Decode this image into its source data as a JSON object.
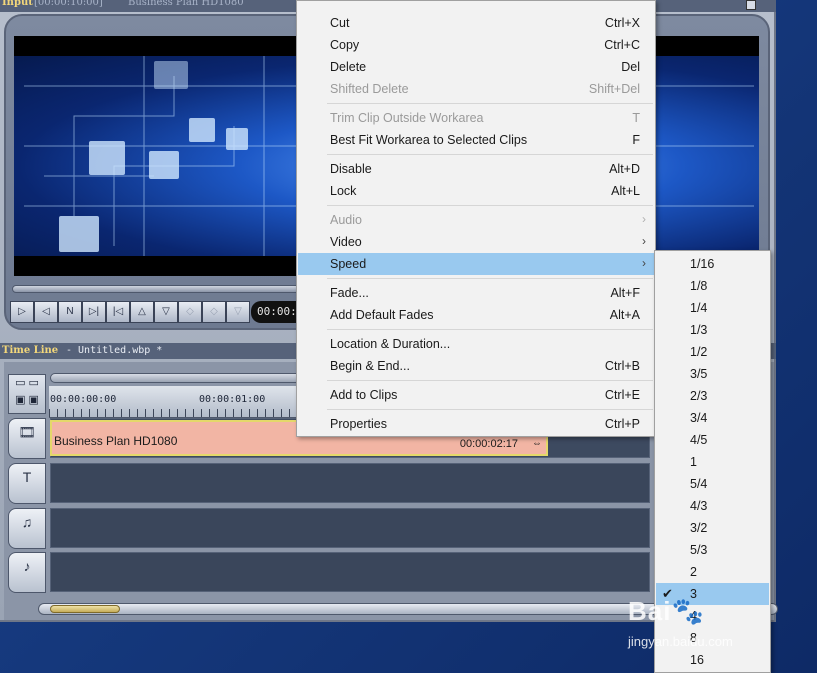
{
  "input_window": {
    "title": "Input",
    "timecode": "[00:00:10:00]",
    "clip_name": "Business Plan HD1080",
    "transport_timecode": "00:00:"
  },
  "timeline": {
    "title": "Time Line",
    "file": "- Untitled.wbp *",
    "ruler": {
      "start": "00:00:00:00",
      "mark": "00:00:01:00"
    },
    "clip": {
      "name": "Business Plan HD1080",
      "duration": "00:00:02:17"
    }
  },
  "context_menu": {
    "items": [
      {
        "label": "Cut",
        "shortcut": "Ctrl+X",
        "enabled": true
      },
      {
        "label": "Copy",
        "shortcut": "Ctrl+C",
        "enabled": true
      },
      {
        "label": "Delete",
        "shortcut": "Del",
        "enabled": true
      },
      {
        "label": "Shifted Delete",
        "shortcut": "Shift+Del",
        "enabled": false
      },
      {
        "label": "Trim Clip Outside Workarea",
        "shortcut": "T",
        "enabled": false
      },
      {
        "label": "Best Fit Workarea to Selected Clips",
        "shortcut": "F",
        "enabled": true
      },
      {
        "label": "Disable",
        "shortcut": "Alt+D",
        "enabled": true
      },
      {
        "label": "Lock",
        "shortcut": "Alt+L",
        "enabled": true
      },
      {
        "label": "Audio",
        "shortcut": "",
        "enabled": false,
        "submenu": true
      },
      {
        "label": "Video",
        "shortcut": "",
        "enabled": true,
        "submenu": true
      },
      {
        "label": "Speed",
        "shortcut": "",
        "enabled": true,
        "submenu": true,
        "highlighted": true
      },
      {
        "label": "Fade...",
        "shortcut": "Alt+F",
        "enabled": true
      },
      {
        "label": "Add Default Fades",
        "shortcut": "Alt+A",
        "enabled": true
      },
      {
        "label": "Location & Duration...",
        "shortcut": "",
        "enabled": true
      },
      {
        "label": "Begin & End...",
        "shortcut": "Ctrl+B",
        "enabled": true
      },
      {
        "label": "Add to Clips",
        "shortcut": "Ctrl+E",
        "enabled": true
      },
      {
        "label": "Properties",
        "shortcut": "Ctrl+P",
        "enabled": true
      }
    ]
  },
  "speed_submenu": {
    "options": [
      "1/16",
      "1/8",
      "1/4",
      "1/3",
      "1/2",
      "3/5",
      "2/3",
      "3/4",
      "4/5",
      "1",
      "5/4",
      "4/3",
      "3/2",
      "5/3",
      "2",
      "3",
      "4",
      "8",
      "16"
    ],
    "selected": "3"
  },
  "watermark": {
    "brand": "Bai",
    "url": "jingyan.baidu.com"
  },
  "colors": {
    "menu_highlight": "#99c9ef",
    "clip": "#f2b5a4",
    "title_text": "#f3d77a"
  }
}
